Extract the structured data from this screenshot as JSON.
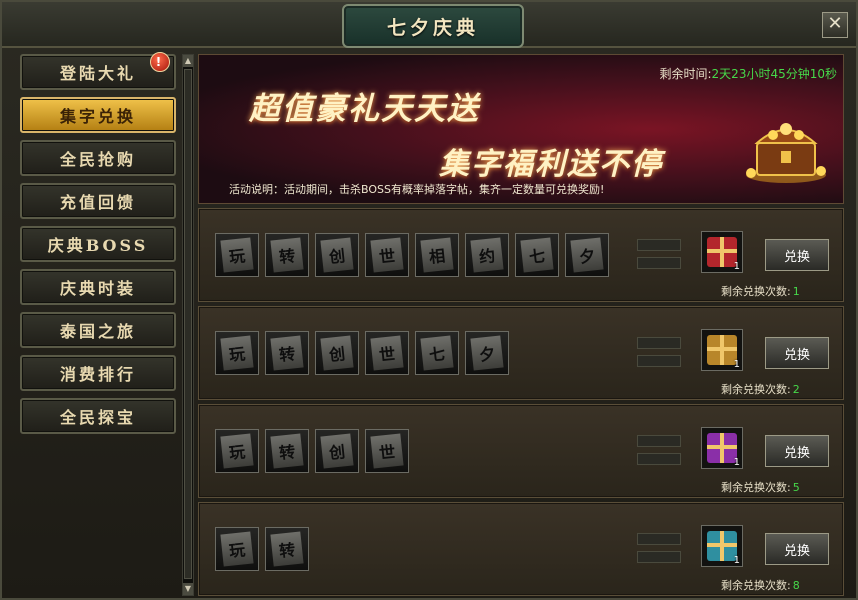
{
  "window": {
    "title": "七夕庆典",
    "close_label": "✕"
  },
  "sidebar": {
    "items": [
      {
        "label": "登陆大礼",
        "active": false,
        "badge": "!"
      },
      {
        "label": "集字兑换",
        "active": true
      },
      {
        "label": "全民抢购",
        "active": false
      },
      {
        "label": "充值回馈",
        "active": false
      },
      {
        "label": "庆典BOSS",
        "active": false
      },
      {
        "label": "庆典时装",
        "active": false
      },
      {
        "label": "泰国之旅",
        "active": false
      },
      {
        "label": "消费排行",
        "active": false
      },
      {
        "label": "全民探宝",
        "active": false
      }
    ]
  },
  "banner": {
    "headline": "超值豪礼天天送",
    "subheadline": "集字福利送不停",
    "timer_label": "剩余时间:",
    "timer_value": "2天23小时45分钟10秒",
    "activity_text": "活动说明：活动期间，击杀BOSS有概率掉落字帖，集齐一定数量可兑换奖励!"
  },
  "exchange_rows": [
    {
      "chars": [
        "玩",
        "转",
        "创",
        "世",
        "相",
        "约",
        "七",
        "夕"
      ],
      "gift_color": "#b3262c",
      "qty": "1",
      "button": "兑换",
      "remain_label": "剩余兑换次数:",
      "remain_count": "1"
    },
    {
      "chars": [
        "玩",
        "转",
        "创",
        "世",
        "七",
        "夕"
      ],
      "gift_color": "#b8862a",
      "qty": "1",
      "button": "兑换",
      "remain_label": "剩余兑换次数:",
      "remain_count": "2"
    },
    {
      "chars": [
        "玩",
        "转",
        "创",
        "世"
      ],
      "gift_color": "#8a2fa8",
      "qty": "1",
      "button": "兑换",
      "remain_label": "剩余兑换次数:",
      "remain_count": "5"
    },
    {
      "chars": [
        "玩",
        "转"
      ],
      "gift_color": "#2f8fa0",
      "qty": "1",
      "button": "兑换",
      "remain_label": "剩余兑换次数:",
      "remain_count": "8"
    }
  ],
  "scrollbar": {
    "up": "▲",
    "down": "▼"
  }
}
